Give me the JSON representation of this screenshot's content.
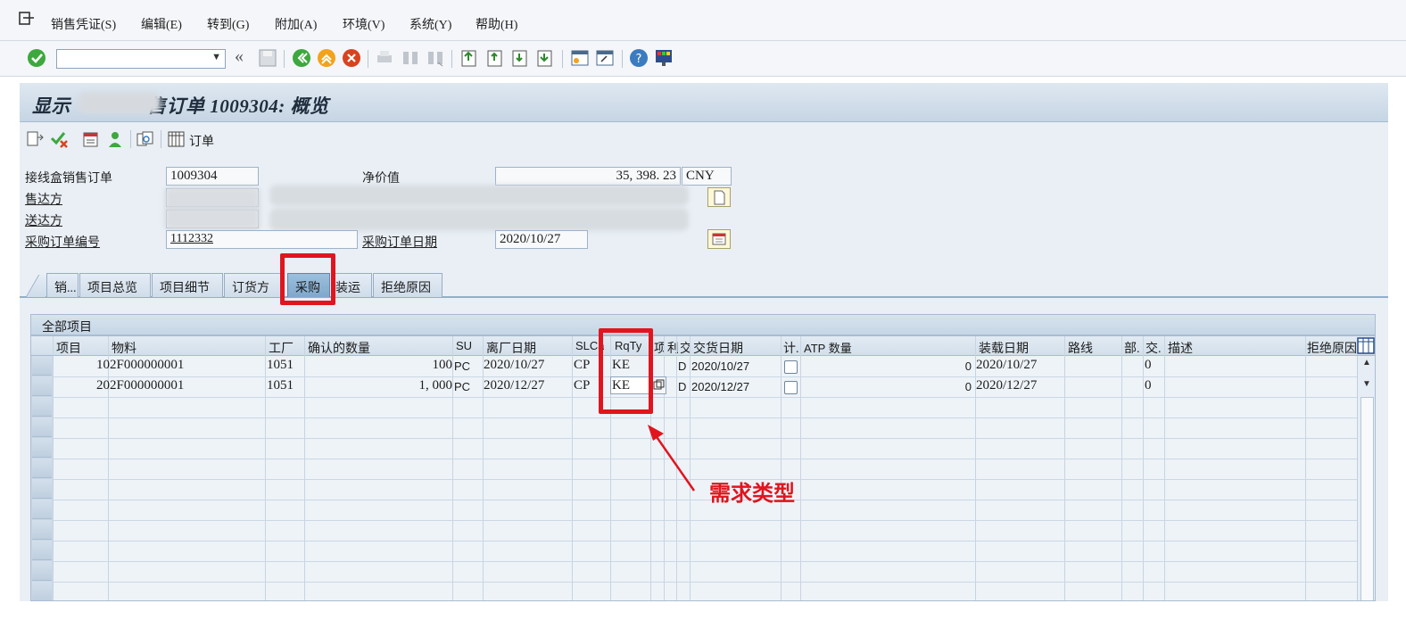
{
  "menu": {
    "items": [
      "销售凭证(S)",
      "编辑(E)",
      "转到(G)",
      "附加(A)",
      "环境(V)",
      "系统(Y)",
      "帮助(H)"
    ]
  },
  "toolbar": {
    "command_value": ""
  },
  "title": {
    "prefix": "显示",
    "suffix": "售订单 1009304: 概览"
  },
  "appbar": {
    "order_label": "订单"
  },
  "header": {
    "order_label": "接线盒销售订单",
    "order_value": "1009304",
    "net_value_label": "净价值",
    "net_value": "35, 398. 23",
    "currency": "CNY",
    "sold_to_label": "售达方",
    "ship_to_label": "送达方",
    "po_number_label": "采购订单编号",
    "po_number_value": "1112332",
    "po_date_label": "采购订单日期",
    "po_date_value": "2020/10/27"
  },
  "tabs": [
    "销...",
    "项目总览",
    "项目细节",
    "订货方",
    "采购",
    "装运",
    "拒绝原因"
  ],
  "active_tab": "采购",
  "group_title": "全部项目",
  "columns": {
    "item": "项目",
    "material": "物料",
    "plant": "工厂",
    "confirmed_qty": "确认的数量",
    "su": "SU",
    "ship_date": "离厂日期",
    "slca": "SLCa",
    "rqty": "RqTy",
    "c1": "项",
    "c2": "利",
    "c3": "交",
    "delivery_date": "交货日期",
    "calc": "计.",
    "atp_qty": "ATP 数量",
    "load_date": "装载日期",
    "route": "路线",
    "part": "部.",
    "deliv": "交.",
    "desc": "描述",
    "reject": "拒绝原因"
  },
  "rows": [
    {
      "item": "10",
      "material": "2F000000001",
      "plant": "1051",
      "qty": "100",
      "su": "PC",
      "ship_date": "2020/10/27",
      "slca": "CP",
      "rqty": "KE",
      "flag": "D",
      "delivery_date": "2020/10/27",
      "atp": "0",
      "load_date": "2020/10/27",
      "deliv": "0"
    },
    {
      "item": "20",
      "material": "2F000000001",
      "plant": "1051",
      "qty": "1, 000",
      "su": "PC",
      "ship_date": "2020/12/27",
      "slca": "CP",
      "rqty": "KE",
      "flag": "D",
      "delivery_date": "2020/12/27",
      "atp": "0",
      "load_date": "2020/12/27",
      "deliv": "0"
    }
  ],
  "annotation": {
    "text": "需求类型",
    "color": "#e0151e"
  }
}
